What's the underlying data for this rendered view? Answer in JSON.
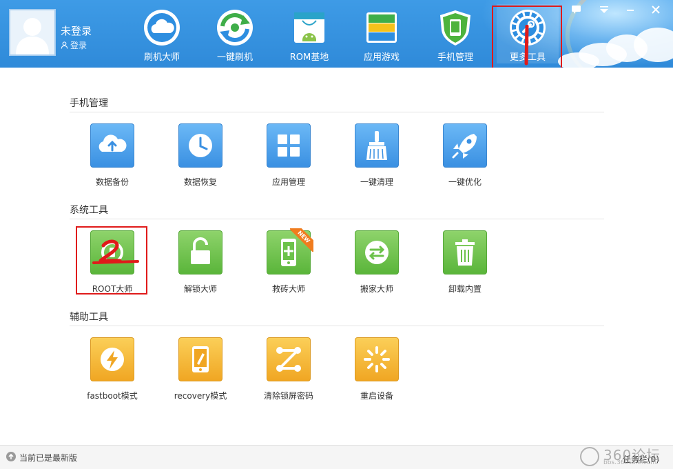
{
  "header": {
    "user_name": "未登录",
    "login_label": "登录",
    "nav": [
      {
        "label": "刷机大师",
        "icon": "cloud-icon"
      },
      {
        "label": "一键刷机",
        "icon": "refresh-arrows-icon"
      },
      {
        "label": "ROM基地",
        "icon": "android-bag-icon"
      },
      {
        "label": "应用游戏",
        "icon": "app-stack-icon"
      },
      {
        "label": "手机管理",
        "icon": "phone-shield-icon"
      },
      {
        "label": "更多工具",
        "icon": "gear-wrench-icon",
        "active": true
      }
    ],
    "annotation_1": "1"
  },
  "sections": [
    {
      "title": "手机管理",
      "tools": [
        {
          "label": "数据备份",
          "icon": "cloud-upload-icon",
          "color": "blue"
        },
        {
          "label": "数据恢复",
          "icon": "clock-icon",
          "color": "blue"
        },
        {
          "label": "应用管理",
          "icon": "app-grid-icon",
          "color": "blue"
        },
        {
          "label": "一键清理",
          "icon": "broom-icon",
          "color": "blue"
        },
        {
          "label": "一键优化",
          "icon": "rocket-icon",
          "color": "blue"
        }
      ]
    },
    {
      "title": "系统工具",
      "tools": [
        {
          "label": "ROOT大师",
          "icon": "root-power-icon",
          "color": "green"
        },
        {
          "label": "解锁大师",
          "icon": "unlock-icon",
          "color": "green"
        },
        {
          "label": "救砖大师",
          "icon": "phone-plus-icon",
          "color": "green",
          "badge": "NEW"
        },
        {
          "label": "搬家大师",
          "icon": "transfer-arrows-icon",
          "color": "green"
        },
        {
          "label": "卸载内置",
          "icon": "trash-icon",
          "color": "green"
        }
      ]
    },
    {
      "title": "辅助工具",
      "tools": [
        {
          "label": "fastboot模式",
          "icon": "lightning-icon",
          "color": "orange"
        },
        {
          "label": "recovery模式",
          "icon": "phone-pen-icon",
          "color": "orange"
        },
        {
          "label": "清除锁屏密码",
          "icon": "pattern-lock-icon",
          "color": "orange"
        },
        {
          "label": "重启设备",
          "icon": "spinner-icon",
          "color": "orange"
        }
      ]
    }
  ],
  "annotation_2": "2",
  "status": {
    "text": "当前已是最新版",
    "task_label": "任务栏(0)"
  },
  "watermark": {
    "text": "360论坛",
    "sub": "bbs.360safe.com"
  },
  "colors": {
    "header_blue": "#3a93e0",
    "blue_tile": "#4a9fe9",
    "green_tile": "#6cc24a",
    "orange_tile": "#f5b534",
    "annotation_red": "#e01a1a"
  }
}
